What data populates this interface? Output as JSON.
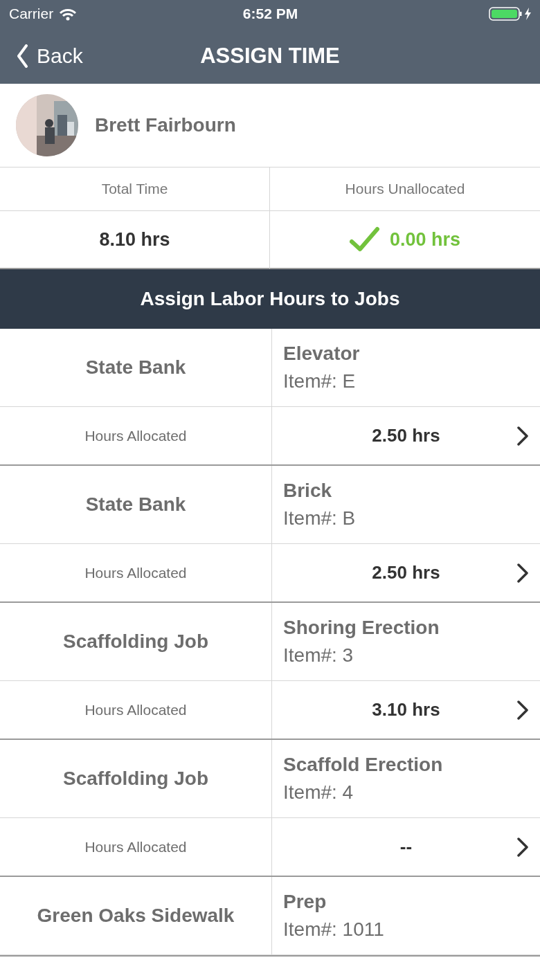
{
  "status_bar": {
    "carrier": "Carrier",
    "time": "6:52 PM"
  },
  "nav": {
    "back": "Back",
    "title": "ASSIGN TIME"
  },
  "employee": {
    "name": "Brett Fairbourn"
  },
  "summary": {
    "total_label": "Total Time",
    "total_value": "8.10 hrs",
    "unallocated_label": "Hours Unallocated",
    "unallocated_value": "0.00 hrs",
    "balanced": true
  },
  "section_title": "Assign Labor Hours to Jobs",
  "jobs": [
    {
      "job": "State Bank",
      "item": "Elevator",
      "item_number": "Item#: E",
      "hours_label": "Hours Allocated",
      "hours": "2.50 hrs"
    },
    {
      "job": "State Bank",
      "item": "Brick",
      "item_number": "Item#: B",
      "hours_label": "Hours Allocated",
      "hours": "2.50 hrs"
    },
    {
      "job": "Scaffolding Job",
      "item": "Shoring Erection",
      "item_number": "Item#: 3",
      "hours_label": "Hours Allocated",
      "hours": "3.10 hrs"
    },
    {
      "job": "Scaffolding Job",
      "item": "Scaffold Erection",
      "item_number": "Item#: 4",
      "hours_label": "Hours Allocated",
      "hours": "--"
    },
    {
      "job": "Green Oaks Sidewalk",
      "item": "Prep",
      "item_number": "Item#: 1011"
    }
  ]
}
